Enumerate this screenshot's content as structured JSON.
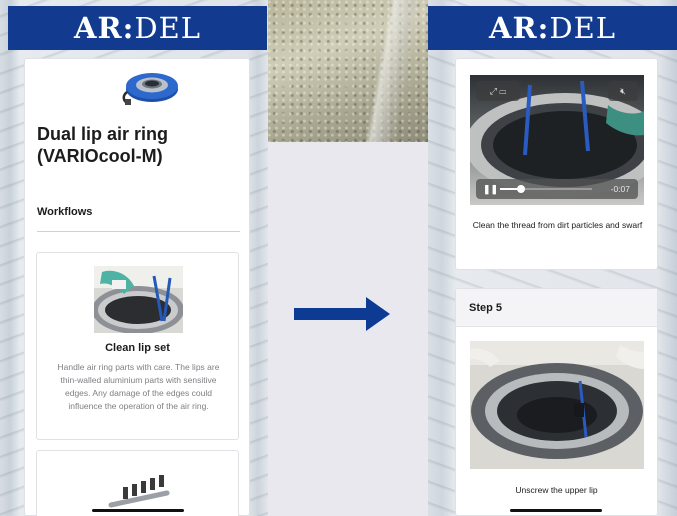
{
  "brand": {
    "strong": "AR:",
    "light": "DEL"
  },
  "left_screen": {
    "product_title": "Dual lip air ring (VARIOcool-M)",
    "workflows_heading": "Workflows",
    "workflow_cards": [
      {
        "title": "Clean lip set",
        "description": "Handle air ring parts with care. The lips are thin-walled aluminium parts with sensitive edges. Any damage of the edges could influence the operation of the air ring."
      }
    ]
  },
  "right_screen": {
    "video": {
      "time_remaining": "-0:07",
      "progress": 0.23,
      "caption": "Clean the thread from dirt particles and swarf"
    },
    "step": {
      "label": "Step 5",
      "caption": "Unscrew the upper lip"
    }
  },
  "colors": {
    "brand_blue": "#123a8f",
    "arrow_blue": "#0d3b94",
    "card_bg": "#ffffff",
    "muted_text": "#7d7f83"
  },
  "icons": [
    "expand-icon",
    "picture-in-picture-icon",
    "mute-icon",
    "pause-icon",
    "arrow-right-icon"
  ]
}
